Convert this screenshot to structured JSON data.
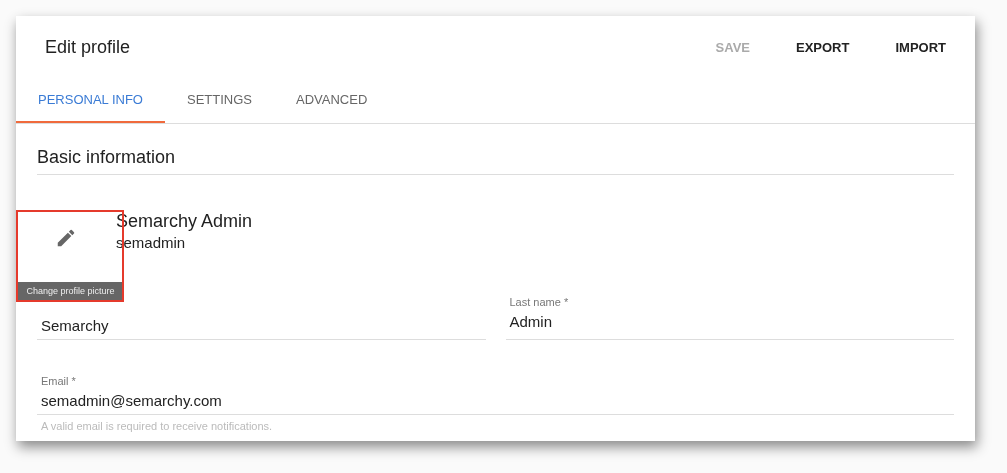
{
  "header": {
    "title": "Edit profile",
    "actions": [
      {
        "label": "SAVE",
        "disabled": true
      },
      {
        "label": "EXPORT",
        "disabled": false
      },
      {
        "label": "IMPORT",
        "disabled": false
      }
    ]
  },
  "tabs": [
    {
      "label": "PERSONAL INFO",
      "selected": true
    },
    {
      "label": "SETTINGS",
      "selected": false
    },
    {
      "label": "ADVANCED",
      "selected": false
    }
  ],
  "section": {
    "title": "Basic information"
  },
  "profile": {
    "display_name": "Semarchy Admin",
    "username": "semadmin",
    "tooltip": "Change profile picture"
  },
  "fields": [
    {
      "label": "Last name *",
      "value": "Admin"
    }
  ],
  "first_name": {
    "value": "Semarchy"
  },
  "email": {
    "label": "Email *",
    "value": "semadmin@semarchy.com",
    "hint": "A valid email is required to receive notifications."
  }
}
